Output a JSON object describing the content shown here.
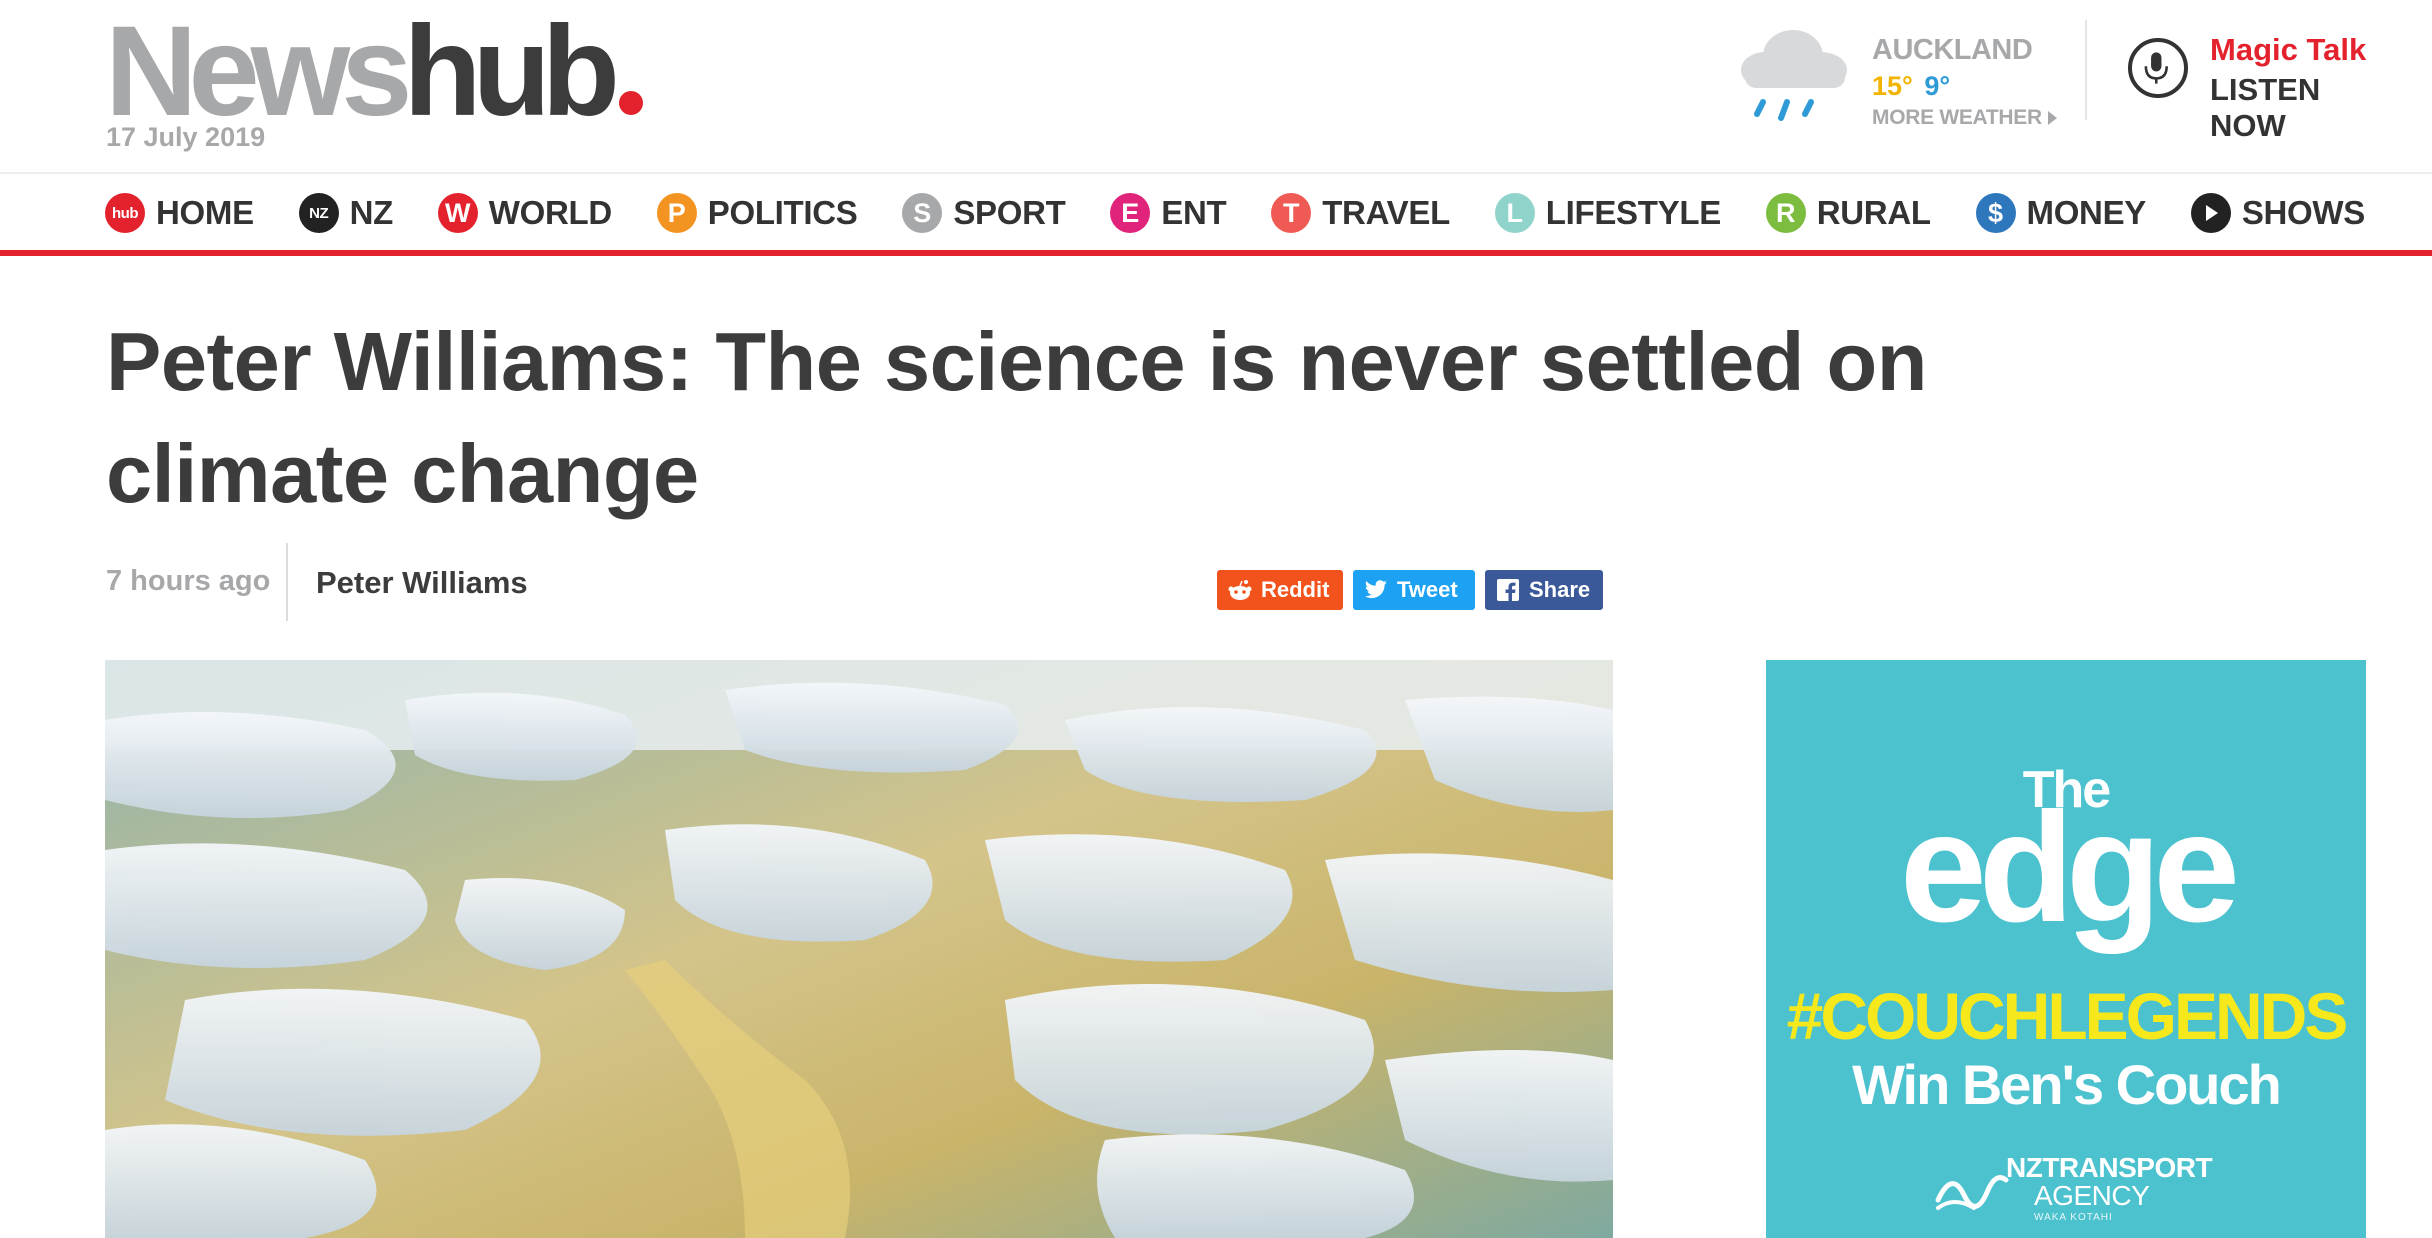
{
  "header": {
    "logo": {
      "part1": "News",
      "part2": "hub",
      "dot_color": "#e4222e"
    },
    "date": "17 July 2019",
    "weather": {
      "city": "AUCKLAND",
      "high": "15°",
      "low": "9°",
      "more_label": "MORE WEATHER",
      "icon": "rain-cloud-icon"
    },
    "radio": {
      "brand": "Magic Talk",
      "cta": "LISTEN NOW",
      "icon": "microphone-icon"
    }
  },
  "nav": {
    "items": [
      {
        "label": "HOME",
        "badge": "hub",
        "color": "#e4222e"
      },
      {
        "label": "NZ",
        "badge": "NZ",
        "color": "#222222"
      },
      {
        "label": "WORLD",
        "badge": "W",
        "color": "#e4222e"
      },
      {
        "label": "POLITICS",
        "badge": "P",
        "color": "#f39322"
      },
      {
        "label": "SPORT",
        "badge": "S",
        "color": "#a7a8aa"
      },
      {
        "label": "ENT",
        "badge": "E",
        "color": "#e0237b"
      },
      {
        "label": "TRAVEL",
        "badge": "T",
        "color": "#ef5a55"
      },
      {
        "label": "LIFESTYLE",
        "badge": "L",
        "color": "#8fd3ca"
      },
      {
        "label": "RURAL",
        "badge": "R",
        "color": "#7cbc3f"
      },
      {
        "label": "MONEY",
        "badge": "$",
        "color": "#2f77bc"
      },
      {
        "label": "SHOWS",
        "badge": "play",
        "color": "#222222"
      }
    ],
    "accent": "#e4222e"
  },
  "article": {
    "headline": "Peter Williams: The science is never settled on climate change",
    "time_ago": "7 hours ago",
    "author": "Peter Williams",
    "share": {
      "reddit": "Reddit",
      "tweet": "Tweet",
      "facebook": "Share"
    },
    "hero_alt": "Melting sea ice"
  },
  "ad": {
    "brand_small": "The",
    "brand_large": "edge",
    "hashtag": "#COUCHLEGENDS",
    "tagline": "Win Ben's Couch",
    "sponsor_nz": "NZ",
    "sponsor_line1": "TRANSPORT",
    "sponsor_line2": "AGENCY",
    "sponsor_sub": "WAKA KOTAHI",
    "bg_color": "#4cc2cf",
    "tag_color": "#f6e81a"
  }
}
